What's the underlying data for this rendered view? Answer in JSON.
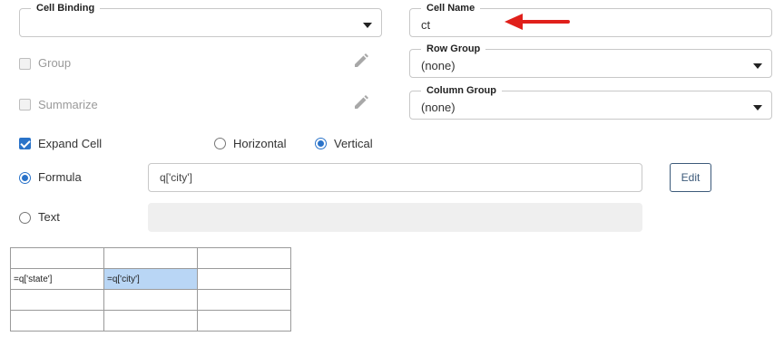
{
  "cell_binding": {
    "legend": "Cell Binding",
    "value": ""
  },
  "cell_name": {
    "legend": "Cell Name",
    "value": "ct"
  },
  "row_group": {
    "legend": "Row Group",
    "value": "(none)"
  },
  "column_group": {
    "legend": "Column Group",
    "value": "(none)"
  },
  "options": {
    "group": {
      "label": "Group",
      "checked": false,
      "enabled": false
    },
    "summarize": {
      "label": "Summarize",
      "checked": false,
      "enabled": false
    },
    "expand_cell": {
      "label": "Expand Cell",
      "checked": true
    }
  },
  "expand_direction": {
    "horizontal_label": "Horizontal",
    "vertical_label": "Vertical",
    "selected": "Vertical"
  },
  "content_type": {
    "formula_label": "Formula",
    "text_label": "Text",
    "selected": "Formula",
    "formula_value": "q['city']",
    "text_value": "",
    "edit_label": "Edit"
  },
  "grid": {
    "rows": [
      [
        "",
        "",
        ""
      ],
      [
        "=q['state']",
        "=q['city']",
        ""
      ],
      [
        "",
        "",
        ""
      ],
      [
        "",
        "",
        ""
      ]
    ],
    "selected_cell": [
      1,
      1
    ]
  },
  "colors": {
    "accent": "#2a73c9",
    "selected_cell": "#b9d6f5",
    "annotation_arrow": "#e0201b"
  }
}
